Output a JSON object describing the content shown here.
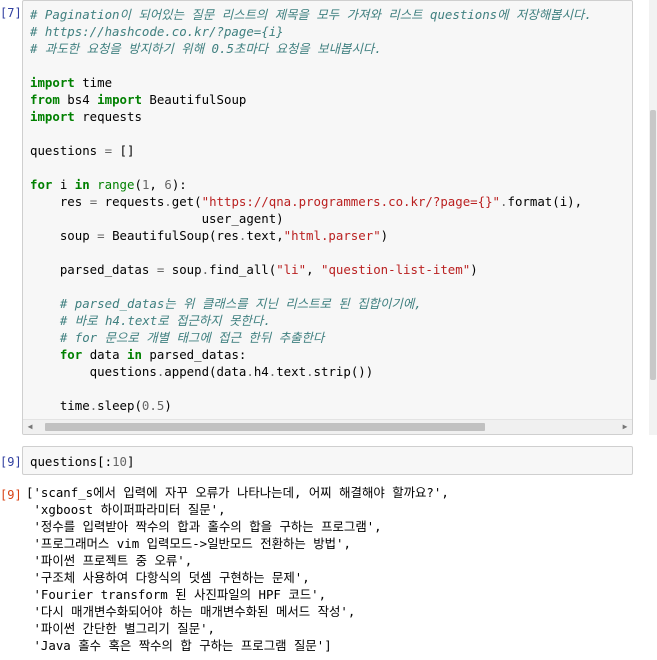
{
  "cells": [
    {
      "prompt": "[7]:",
      "lines": [
        [
          [
            "c",
            "# Pagination이 되어있는 질문 리스트의 제목을 모두 가져와 리스트 questions에 저장해봅시다."
          ]
        ],
        [
          [
            "c",
            "# https://hashcode.co.kr/?page={i}"
          ]
        ],
        [
          [
            "c",
            "# 과도한 요청을 방지하기 위해 0.5초마다 요청을 보내봅시다."
          ]
        ],
        [],
        [
          [
            "k",
            "import"
          ],
          [
            "",
            " time"
          ]
        ],
        [
          [
            "k",
            "from"
          ],
          [
            "",
            " bs4 "
          ],
          [
            "k",
            "import"
          ],
          [
            "",
            " BeautifulSoup"
          ]
        ],
        [
          [
            "k",
            "import"
          ],
          [
            "",
            " requests"
          ]
        ],
        [],
        [
          [
            "",
            "questions "
          ],
          [
            "o",
            "="
          ],
          [
            "",
            " []"
          ]
        ],
        [],
        [
          [
            "k",
            "for"
          ],
          [
            "",
            " i "
          ],
          [
            "k",
            "in"
          ],
          [
            "",
            " "
          ],
          [
            "n",
            "range"
          ],
          [
            "",
            "("
          ],
          [
            "m",
            "1"
          ],
          [
            "",
            ", "
          ],
          [
            "m",
            "6"
          ],
          [
            "",
            "):"
          ]
        ],
        [
          [
            "",
            "    res "
          ],
          [
            "o",
            "="
          ],
          [
            "",
            " requests"
          ],
          [
            "o",
            "."
          ],
          [
            "",
            "get("
          ],
          [
            "s",
            "\"https://qna.programmers.co.kr/?page={}\""
          ],
          [
            "o",
            "."
          ],
          [
            "",
            "format(i),"
          ]
        ],
        [
          [
            "",
            "                       user_agent)"
          ]
        ],
        [
          [
            "",
            "    soup "
          ],
          [
            "o",
            "="
          ],
          [
            "",
            " BeautifulSoup(res"
          ],
          [
            "o",
            "."
          ],
          [
            "",
            "text,"
          ],
          [
            "s",
            "\"html.parser\""
          ],
          [
            "",
            ")"
          ]
        ],
        [],
        [
          [
            "",
            "    parsed_datas "
          ],
          [
            "o",
            "="
          ],
          [
            "",
            " soup"
          ],
          [
            "o",
            "."
          ],
          [
            "",
            "find_all("
          ],
          [
            "s",
            "\"li\""
          ],
          [
            "",
            ", "
          ],
          [
            "s",
            "\"question-list-item\""
          ],
          [
            "",
            ")"
          ]
        ],
        [],
        [
          [
            "",
            "    "
          ],
          [
            "c",
            "# parsed_datas는 위 클래스를 지닌 리스트로 된 집합이기에,"
          ]
        ],
        [
          [
            "",
            "    "
          ],
          [
            "c",
            "# 바로 h4.text로 접근하지 못한다."
          ]
        ],
        [
          [
            "",
            "    "
          ],
          [
            "c",
            "# for 문으로 개별 태그에 접근 한뒤 추출한다"
          ]
        ],
        [
          [
            "",
            "    "
          ],
          [
            "k",
            "for"
          ],
          [
            "",
            " data "
          ],
          [
            "k",
            "in"
          ],
          [
            "",
            " parsed_datas:"
          ]
        ],
        [
          [
            "",
            "        questions"
          ],
          [
            "o",
            "."
          ],
          [
            "",
            "append(data"
          ],
          [
            "o",
            "."
          ],
          [
            "",
            "h4"
          ],
          [
            "o",
            "."
          ],
          [
            "",
            "text"
          ],
          [
            "o",
            "."
          ],
          [
            "",
            "strip())"
          ]
        ],
        [],
        [
          [
            "",
            "    time"
          ],
          [
            "o",
            "."
          ],
          [
            "",
            "sleep("
          ],
          [
            "m",
            "0.5"
          ],
          [
            "",
            ")"
          ]
        ]
      ]
    },
    {
      "prompt": "[9]:",
      "lines": [
        [
          [
            "",
            "questions[:"
          ],
          [
            "m",
            "10"
          ],
          [
            "",
            "]"
          ]
        ]
      ]
    }
  ],
  "output": {
    "prompt": "[9]:",
    "lines": [
      "['scanf_s에서 입력에 자꾸 오류가 나타나는데, 어찌 해결해야 할까요?',",
      " 'xgboost 하이퍼파라미터 질문',",
      " '정수를 입력받아 짝수의 합과 홀수의 합을 구하는 프로그램',",
      " '프로그래머스 vim 입력모드->일반모드 전환하는 방법',",
      " '파이썬 프로젝트 중 오류',",
      " '구조체 사용하여 다항식의 덧셈 구현하는 문제',",
      " 'Fourier transform 된 사진파일의 HPF 코드',",
      " '다시 매개변수화되어야 하는 매개변수화된 메서드 작성',",
      " '파이썬 간단한 별그리기 질문',",
      " 'Java 홀수 혹은 짝수의 합 구하는 프로그램 질문']"
    ]
  },
  "icons": {
    "scroll_left": "chevron-left-icon",
    "scroll_right": "chevron-right-icon"
  }
}
